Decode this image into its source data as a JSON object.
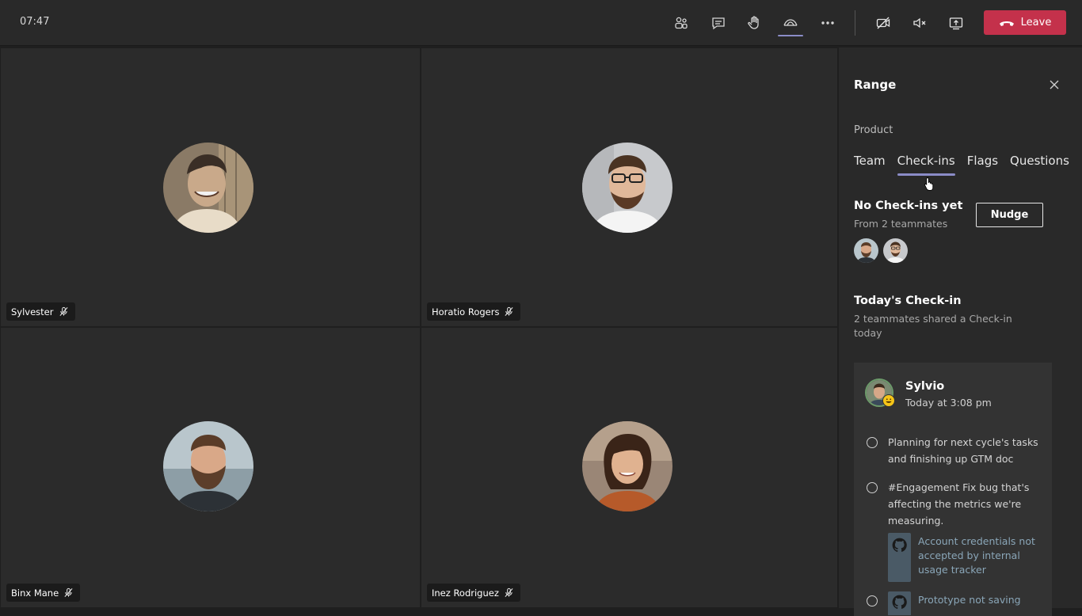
{
  "topbar": {
    "time": "07:47",
    "buttons": [
      {
        "name": "people-icon"
      },
      {
        "name": "chat-icon"
      },
      {
        "name": "raise-hand-icon"
      },
      {
        "name": "range-app-icon",
        "active": true
      },
      {
        "name": "more-options-icon"
      },
      {
        "name": "camera-off-icon"
      },
      {
        "name": "speaker-muted-icon"
      },
      {
        "name": "share-screen-icon"
      }
    ],
    "leave_label": "Leave",
    "leave_color": "#c4314b",
    "accent_color": "#8b8cc7"
  },
  "participants": [
    {
      "name": "Sylvester",
      "muted": true
    },
    {
      "name": "Horatio Rogers",
      "muted": true
    },
    {
      "name": "Binx Mane",
      "muted": true
    },
    {
      "name": "Inez Rodriguez",
      "muted": true
    }
  ],
  "panel": {
    "title": "Range",
    "subtitle": "Product",
    "tabs": [
      {
        "label": "Team",
        "active": false
      },
      {
        "label": "Check-ins",
        "active": true
      },
      {
        "label": "Flags",
        "active": false
      },
      {
        "label": "Questions",
        "active": false
      }
    ],
    "no_checkins": {
      "title": "No Check-ins yet",
      "subtitle": "From 2 teammates",
      "nudge_label": "Nudge"
    },
    "today": {
      "title": "Today's Check-in",
      "subtitle": "2 teammates shared a Check-in today"
    },
    "checkin_card": {
      "author": "Sylvio",
      "time": "Today at 3:08 pm",
      "items": [
        {
          "text": "Planning for next cycle's tasks and finishing up GTM doc"
        },
        {
          "text": "#Engagement Fix bug that's affecting the metrics we're measuring."
        }
      ],
      "attachments": [
        {
          "icon": "github-icon",
          "text": "Account credentials not accepted by internal usage tracker"
        },
        {
          "icon": "github-icon",
          "text": "Prototype not saving"
        }
      ]
    }
  }
}
